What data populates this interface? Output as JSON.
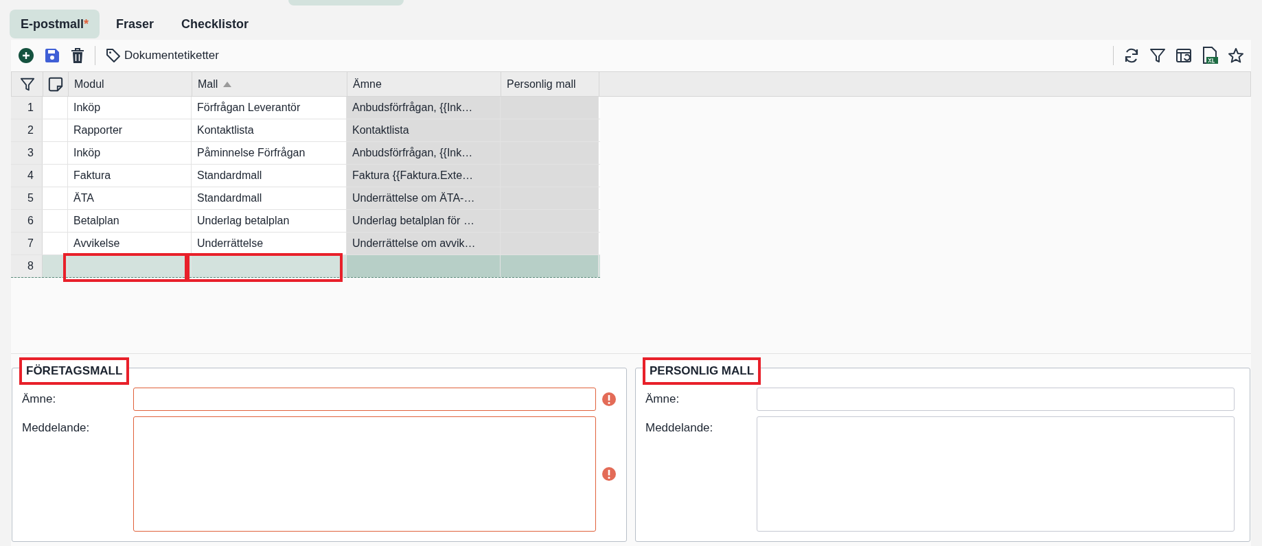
{
  "tabs": [
    {
      "label": "E-postmall",
      "marker": "*",
      "selected": true
    },
    {
      "label": "Fraser",
      "selected": false
    },
    {
      "label": "Checklistor",
      "selected": false
    }
  ],
  "toolbar": {
    "tag_button": "Dokumentetiketter"
  },
  "table": {
    "columns": [
      {
        "label": "Modul",
        "sorted": false,
        "readonly": false
      },
      {
        "label": "Mall",
        "sorted": true,
        "readonly": false
      },
      {
        "label": "Ämne",
        "sorted": false,
        "readonly": true
      },
      {
        "label": "Personlig mall",
        "sorted": false,
        "readonly": true
      }
    ],
    "rows": [
      {
        "number": "1",
        "selected": false,
        "cells": [
          {
            "text": "Inköp",
            "highlighted": false
          },
          {
            "text": "Förfrågan Leverantör",
            "highlighted": false
          },
          {
            "text": "Anbudsförfrågan, {{Ink…",
            "highlighted": false
          },
          {
            "highlighted": false
          }
        ]
      },
      {
        "number": "2",
        "selected": false,
        "cells": [
          {
            "text": "Rapporter",
            "highlighted": false
          },
          {
            "text": "Kontaktlista",
            "highlighted": false
          },
          {
            "text": "Kontaktlista",
            "highlighted": false
          },
          {
            "highlighted": false
          }
        ]
      },
      {
        "number": "3",
        "selected": false,
        "cells": [
          {
            "text": "Inköp",
            "highlighted": false
          },
          {
            "text": "Påminnelse Förfrågan",
            "highlighted": false
          },
          {
            "text": "Anbudsförfrågan, {{Ink…",
            "highlighted": false
          },
          {
            "highlighted": false
          }
        ]
      },
      {
        "number": "4",
        "selected": false,
        "cells": [
          {
            "text": "Faktura",
            "highlighted": false
          },
          {
            "text": "Standardmall",
            "highlighted": false
          },
          {
            "text": "Faktura {{Faktura.Exte…",
            "highlighted": false
          },
          {
            "highlighted": false
          }
        ]
      },
      {
        "number": "5",
        "selected": false,
        "cells": [
          {
            "text": "ÄTA",
            "highlighted": false
          },
          {
            "text": "Standardmall",
            "highlighted": false
          },
          {
            "text": "Underrättelse om ÄTA-…",
            "highlighted": false
          },
          {
            "highlighted": false
          }
        ]
      },
      {
        "number": "6",
        "selected": false,
        "cells": [
          {
            "text": "Betalplan",
            "highlighted": false
          },
          {
            "text": "Underlag betalplan",
            "highlighted": false
          },
          {
            "text": "Underlag betalplan för …",
            "highlighted": false
          },
          {
            "highlighted": false
          }
        ]
      },
      {
        "number": "7",
        "selected": false,
        "cells": [
          {
            "text": "Avvikelse",
            "highlighted": false
          },
          {
            "text": "Underrättelse",
            "highlighted": false
          },
          {
            "text": "Underrättelse om avvik…",
            "highlighted": false
          },
          {
            "highlighted": false
          }
        ]
      },
      {
        "number": "8",
        "selected": true,
        "cells": [
          {
            "highlighted": true
          },
          {
            "highlighted": true
          },
          {
            "highlighted": false
          },
          {
            "highlighted": false
          }
        ]
      }
    ]
  },
  "sections": [
    {
      "title": "FÖRETAGSMALL",
      "highlighted": true,
      "fields": [
        {
          "label": "Ämne:",
          "kind": "input",
          "error": true
        },
        {
          "label": "Meddelande:",
          "kind": "textarea",
          "error": true
        }
      ]
    },
    {
      "title": "PERSONLIG MALL",
      "highlighted": true,
      "fields": [
        {
          "label": "Ämne:",
          "kind": "input",
          "error": false
        },
        {
          "label": "Meddelande:",
          "kind": "textarea",
          "error": false
        }
      ]
    }
  ]
}
